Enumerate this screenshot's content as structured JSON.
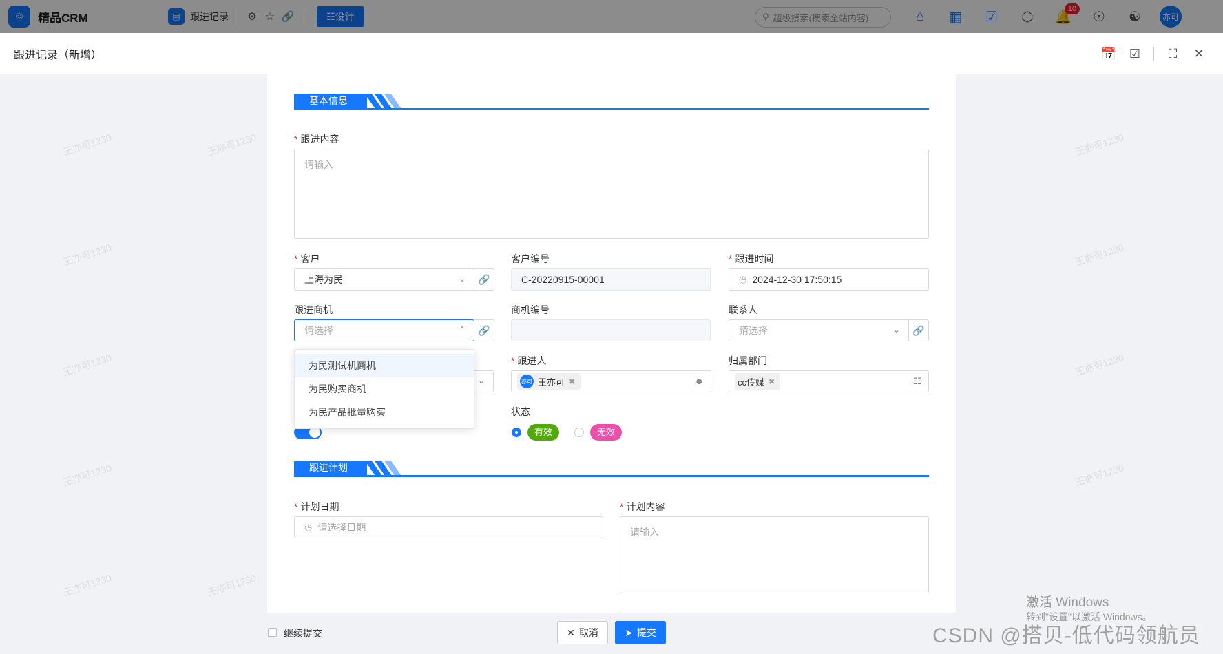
{
  "app": {
    "brand": "精品CRM",
    "logo_icon": "user-icon"
  },
  "topbar": {
    "tab_title": "跟进记录",
    "design_label": "☷设计",
    "search_placeholder": "超级搜索(搜索全站内容)",
    "notification_count": "10",
    "user_avatar": "亦可"
  },
  "dialog": {
    "title": "跟进记录（新增）"
  },
  "sections": {
    "basic": "基本信息",
    "plan": "跟进计划"
  },
  "form": {
    "content_label": "跟进内容",
    "content_placeholder": "请输入",
    "customer_label": "客户",
    "customer_value": "上海为民",
    "customer_no_label": "客户编号",
    "customer_no_value": "C-20220915-00001",
    "followup_time_label": "跟进时间",
    "followup_time_value": "2024-12-30 17:50:15",
    "opportunity_label": "跟进商机",
    "opportunity_placeholder": "请选择",
    "opportunity_no_label": "商机编号",
    "contact_label": "联系人",
    "contact_placeholder": "请选择",
    "follower_label": "跟进人",
    "follower_value": "王亦可",
    "follower_avatar": "亦可",
    "dept_label": "归属部门",
    "dept_value": "cc传媒",
    "status_label": "状态",
    "status_valid": "有效",
    "status_invalid": "无效",
    "plan_date_label": "计划日期",
    "plan_date_placeholder": "请选择日期",
    "plan_content_label": "计划内容",
    "plan_content_placeholder": "请输入"
  },
  "dropdown": {
    "options": [
      "为民测试机商机",
      "为民购买商机",
      "为民产品批量购买"
    ]
  },
  "footer": {
    "continue_label": "继续提交",
    "cancel_label": "取消",
    "submit_label": "提交"
  },
  "overlay": {
    "activate_title": "激活 Windows",
    "activate_sub": "转到\"设置\"以激活 Windows。",
    "csdn": "CSDN @搭贝-低代码领航员",
    "watermark": "王亦可1230"
  },
  "colors": {
    "primary": "#1677ff",
    "valid": "#52a80d",
    "invalid": "#eb4fa9",
    "required": "#f5222d"
  }
}
